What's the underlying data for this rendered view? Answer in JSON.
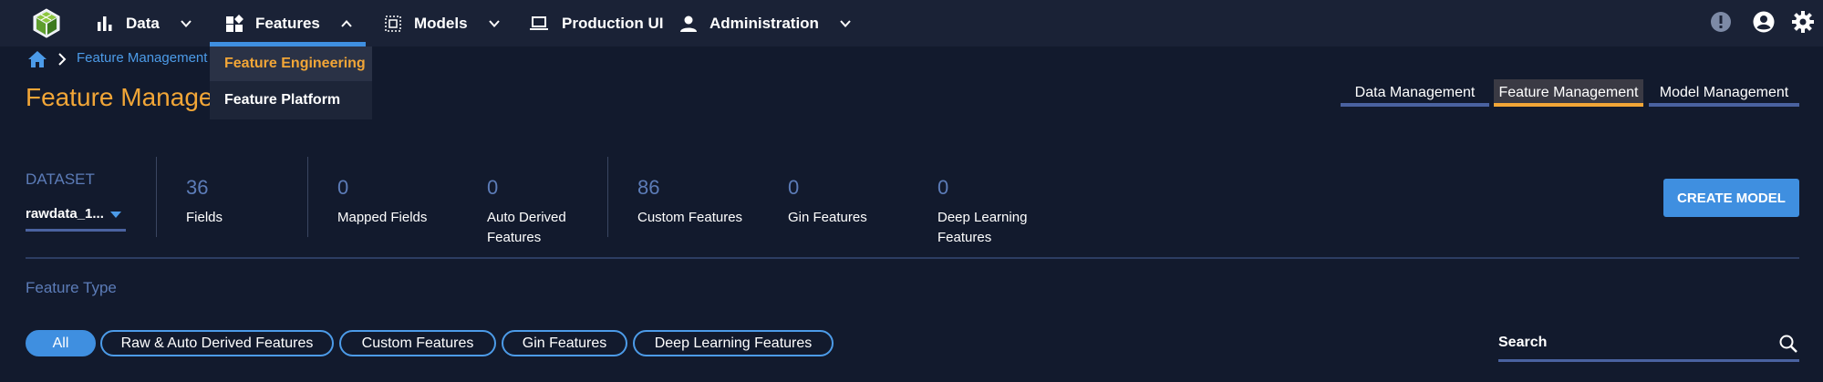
{
  "nav": {
    "items": [
      {
        "label": "Data"
      },
      {
        "label": "Features"
      },
      {
        "label": "Models"
      },
      {
        "label": "Production UI"
      },
      {
        "label": "Administration"
      }
    ],
    "features_menu": [
      "Feature Engineering",
      "Feature Platform"
    ]
  },
  "breadcrumb": {
    "current": "Feature Management"
  },
  "page": {
    "title": "Feature Management"
  },
  "tabs": [
    "Data Management",
    "Feature Management",
    "Model Management"
  ],
  "dataset": {
    "label": "DATASET",
    "value": "rawdata_1..."
  },
  "stats": [
    {
      "value": "36",
      "label": "Fields"
    },
    {
      "value": "0",
      "label": "Mapped Fields"
    },
    {
      "value": "0",
      "label": "Auto Derived Features"
    },
    {
      "value": "86",
      "label": "Custom Features"
    },
    {
      "value": "0",
      "label": "Gin Features"
    },
    {
      "value": "0",
      "label": "Deep Learning Features"
    }
  ],
  "create_model_label": "CREATE MODEL",
  "feature_type_label": "Feature Type",
  "chips": [
    "All",
    "Raw & Auto Derived Features",
    "Custom Features",
    "Gin Features",
    "Deep Learning Features"
  ],
  "search": {
    "label": "Search"
  },
  "colors": {
    "accent": "#3f8fe0",
    "highlight": "#f2a637",
    "background": "#121a2d"
  }
}
